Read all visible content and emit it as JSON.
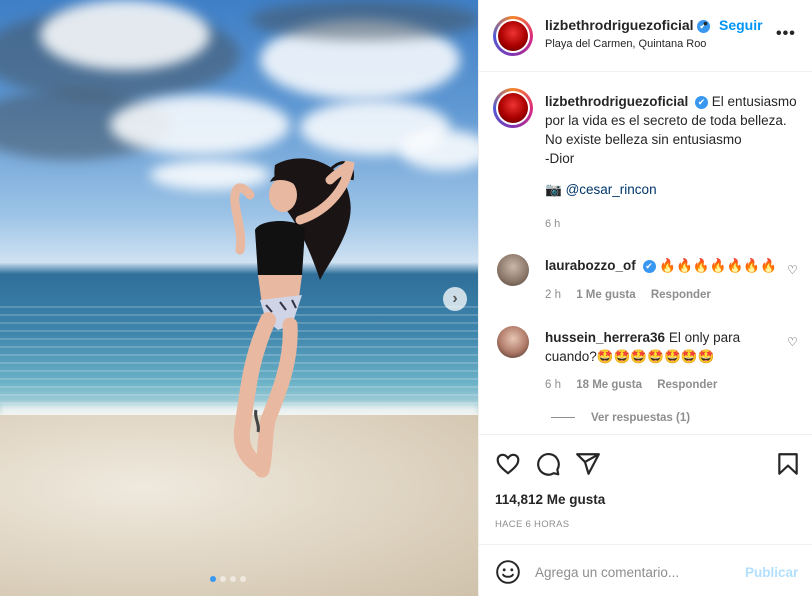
{
  "post": {
    "username": "lizbethrodriguezoficial",
    "verified_mark": "✔",
    "separator": "•",
    "follow_label": "Seguir",
    "location": "Playa del Carmen, Quintana Roo",
    "more_label": "•••",
    "image_alt_icon": "beach-photo"
  },
  "caption": {
    "username": "lizbethrodriguezoficial",
    "lines": [
      "El entusiasmo",
      "por la vida es el secreto de toda belleza.",
      "No existe belleza sin entusiasmo",
      "-Dior"
    ],
    "credit_icon": "📷",
    "credit_mention": "@cesar_rincon",
    "time": "6 h"
  },
  "comments": [
    {
      "username": "laurabozzo_of",
      "verified": true,
      "text": "🔥🔥🔥🔥🔥🔥🔥",
      "time": "2 h",
      "likes": "1 Me gusta",
      "reply": "Responder"
    },
    {
      "username": "hussein_herrera36",
      "verified": false,
      "text": "El only para cuando?🤩🤩🤩🤩🤩🤩🤩",
      "time": "6 h",
      "likes": "18 Me gusta",
      "reply": "Responder"
    }
  ],
  "view_replies": "Ver respuestas (1)",
  "actions": {
    "icons": [
      "heart-icon",
      "comment-icon",
      "share-icon",
      "bookmark-icon"
    ],
    "likes": "114,812 Me gusta",
    "ago": "HACE 6 HORAS"
  },
  "comment_bar": {
    "placeholder": "Agrega un comentario...",
    "publish_label": "Publicar"
  },
  "carousel": {
    "next_label": "›",
    "dot_count": 4,
    "active_index": 0
  },
  "colors": {
    "link_blue": "#0095f6",
    "verified_blue": "#3897f0",
    "publish_disabled": "#b2dffc",
    "muted": "#8e8e8e"
  }
}
